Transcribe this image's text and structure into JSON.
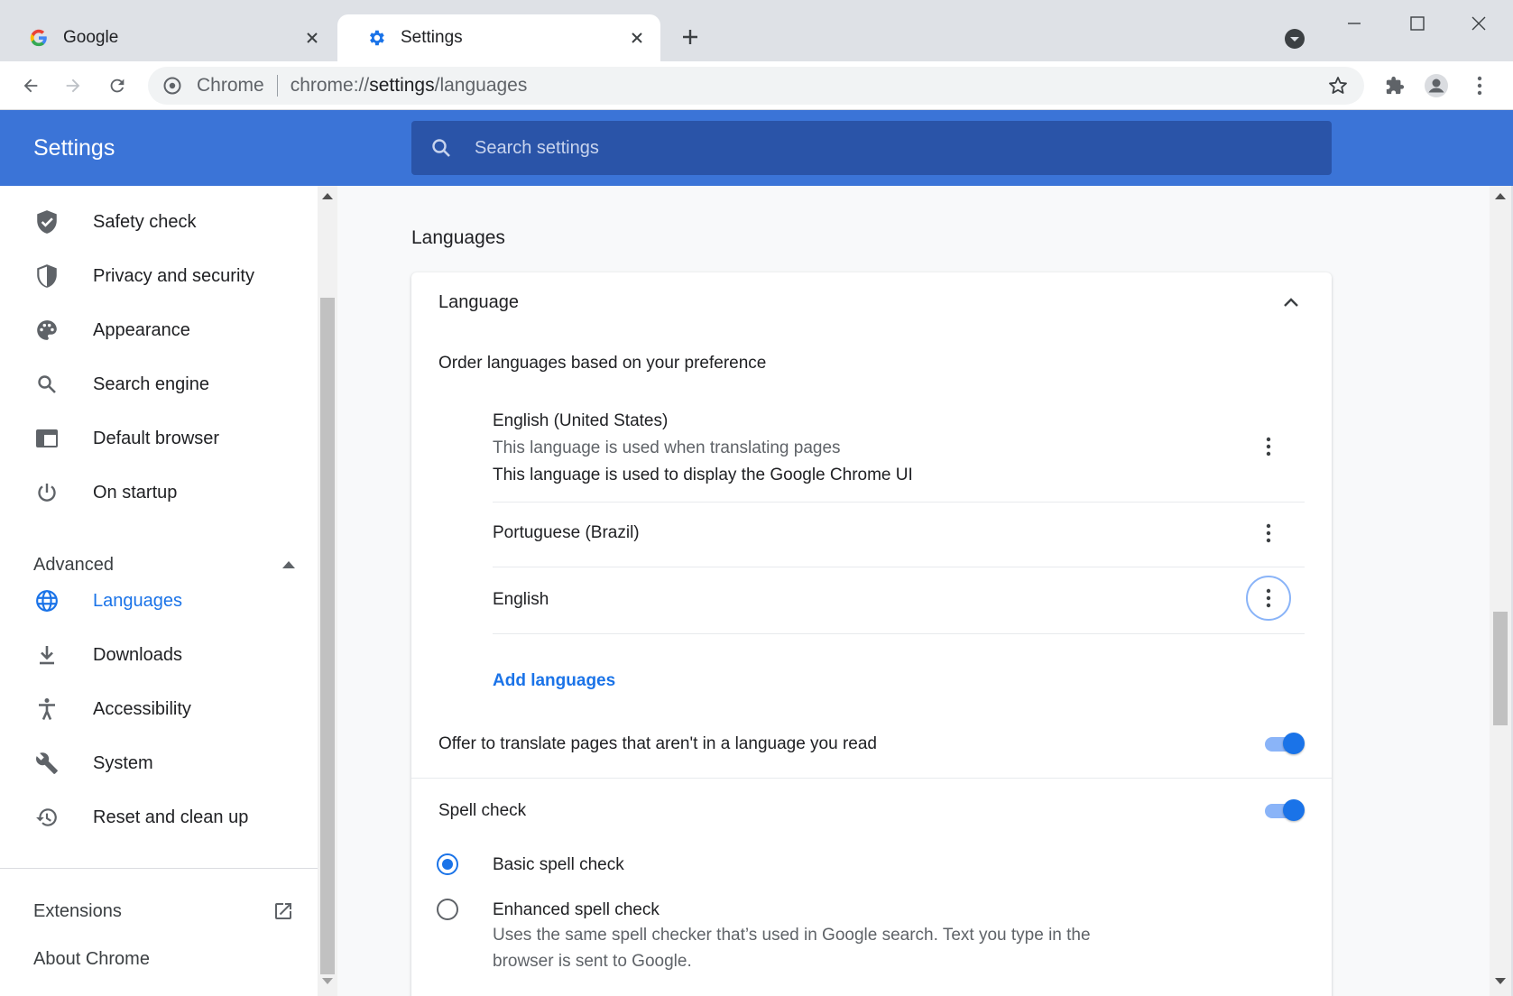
{
  "tabs": [
    {
      "title": "Google",
      "icon": "google-logo"
    },
    {
      "title": "Settings",
      "icon": "gear-icon"
    }
  ],
  "omnibox": {
    "chip": "Chrome",
    "url_prefix": "chrome://",
    "url_host": "settings",
    "url_path": "/languages"
  },
  "header": {
    "title": "Settings",
    "search_placeholder": "Search settings"
  },
  "sidebar": {
    "items": [
      {
        "label": "Safety check",
        "icon": "shield-check-icon"
      },
      {
        "label": "Privacy and security",
        "icon": "shield-icon"
      },
      {
        "label": "Appearance",
        "icon": "palette-icon"
      },
      {
        "label": "Search engine",
        "icon": "search-icon"
      },
      {
        "label": "Default browser",
        "icon": "browser-window-icon"
      },
      {
        "label": "On startup",
        "icon": "power-icon"
      }
    ],
    "advanced_label": "Advanced",
    "advanced_items": [
      {
        "label": "Languages",
        "icon": "globe-icon",
        "active": true
      },
      {
        "label": "Downloads",
        "icon": "download-icon"
      },
      {
        "label": "Accessibility",
        "icon": "accessibility-icon"
      },
      {
        "label": "System",
        "icon": "wrench-icon"
      },
      {
        "label": "Reset and clean up",
        "icon": "history-icon"
      }
    ],
    "extensions_label": "Extensions",
    "about_label": "About Chrome"
  },
  "main": {
    "section_title": "Languages",
    "card_heading": "Language",
    "order_text": "Order languages based on your preference",
    "languages": [
      {
        "name": "English (United States)",
        "desc1": "This language is used when translating pages",
        "desc2": "This language is used to display the Google Chrome UI"
      },
      {
        "name": "Portuguese (Brazil)"
      },
      {
        "name": "English"
      }
    ],
    "add_languages": "Add languages",
    "offer_translate": "Offer to translate pages that aren't in a language you read",
    "offer_translate_on": true,
    "spell_check": "Spell check",
    "spell_check_on": true,
    "basic_spell": "Basic spell check",
    "enhanced_spell": "Enhanced spell check",
    "enhanced_desc": "Uses the same spell checker that’s used in Google search. Text you type in the browser is sent to Google.",
    "selected_spell": "basic"
  },
  "colors": {
    "header": "#3b74d7",
    "accent": "#1a73e8",
    "search_bg": "#2a54a8"
  }
}
